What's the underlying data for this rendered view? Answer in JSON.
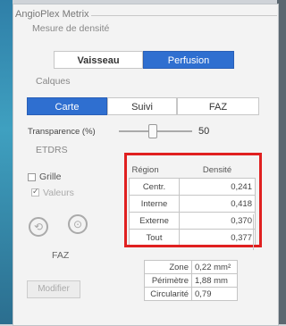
{
  "group_title": "AngioPlex Metrix",
  "density": {
    "title": "Mesure de densité",
    "tabs": [
      "Vaisseau",
      "Perfusion"
    ],
    "active": "Perfusion"
  },
  "layers": {
    "title": "Calques",
    "tabs": [
      "Carte",
      "Suivi",
      "FAZ"
    ],
    "active": "Carte",
    "transparency_label": "Transparence (%)",
    "transparency_value": "50",
    "transparency_level": 0.5
  },
  "etdrs": {
    "title": "ETDRS",
    "grid_label": "Grille",
    "values_label": "Valeurs"
  },
  "faz": {
    "label": "FAZ",
    "modify_label": "Modifier"
  },
  "region_table": {
    "headers": [
      "Région",
      "Densité"
    ],
    "rows": [
      {
        "region": "Centr.",
        "value": "0,241"
      },
      {
        "region": "Interne",
        "value": "0,418"
      },
      {
        "region": "Externe",
        "value": "0,370"
      },
      {
        "region": "Tout",
        "value": "0,377"
      }
    ]
  },
  "metrics": [
    {
      "label": "Zone",
      "value": "0,22 mm²"
    },
    {
      "label": "Périmètre",
      "value": "1,88 mm"
    },
    {
      "label": "Circularité",
      "value": "0,79"
    }
  ],
  "colors": {
    "accent": "#2f6fd0",
    "highlight": "#e02020"
  }
}
